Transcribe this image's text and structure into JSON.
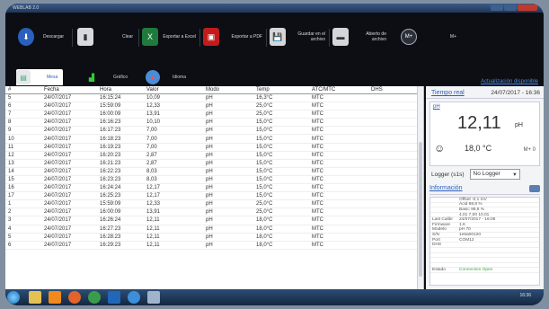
{
  "window": {
    "title": "WEBLAB 2.0"
  },
  "toolbar": {
    "items": [
      {
        "label": "Descargar",
        "icon": "download-icon"
      },
      {
        "label": "Clear",
        "icon": "beaker-icon"
      },
      {
        "label": "Exportar a Excel",
        "icon": "excel-icon"
      },
      {
        "label": "Exportar a PDF",
        "icon": "pdf-icon"
      },
      {
        "label": "Guardar en el archivo",
        "icon": "save-icon"
      },
      {
        "label": "Abierto de archivo",
        "icon": "folder-icon"
      },
      {
        "label": "M+",
        "icon": "memory-plus-icon"
      }
    ]
  },
  "tabs": [
    {
      "label": "Mesa",
      "icon": "table-icon",
      "active": true
    },
    {
      "label": "Gráfico",
      "icon": "chart-icon",
      "active": false
    },
    {
      "label": "Idioma",
      "icon": "globe-icon",
      "active": false
    }
  ],
  "update_link": "Actualización disponible",
  "table": {
    "columns": [
      "#",
      "Fecha",
      "Hora",
      "Valor",
      "Modo",
      "Temp",
      "ATC/MTC",
      "DHS"
    ],
    "rows": [
      [
        "5",
        "24/07/2017",
        "16:15:24",
        "10,09",
        "pH",
        "16,3°C",
        "MTC",
        ""
      ],
      [
        "6",
        "24/07/2017",
        "15:59:09",
        "12,33",
        "pH",
        "25,0°C",
        "MTC",
        ""
      ],
      [
        "7",
        "24/07/2017",
        "16:00:09",
        "13,91",
        "pH",
        "25,0°C",
        "MTC",
        ""
      ],
      [
        "8",
        "24/07/2017",
        "16:16:23",
        "10,10",
        "pH",
        "15,0°C",
        "MTC",
        ""
      ],
      [
        "9",
        "24/07/2017",
        "16:17:23",
        "7,00",
        "pH",
        "15,0°C",
        "MTC",
        ""
      ],
      [
        "10",
        "24/07/2017",
        "16:18:23",
        "7,00",
        "pH",
        "15,0°C",
        "MTC",
        ""
      ],
      [
        "11",
        "24/07/2017",
        "16:19:23",
        "7,00",
        "pH",
        "15,0°C",
        "MTC",
        ""
      ],
      [
        "12",
        "24/07/2017",
        "16:20:23",
        "2,87",
        "pH",
        "15,0°C",
        "MTC",
        ""
      ],
      [
        "13",
        "24/07/2017",
        "16:21:23",
        "2,87",
        "pH",
        "15,0°C",
        "MTC",
        ""
      ],
      [
        "14",
        "24/07/2017",
        "16:22:23",
        "8,03",
        "pH",
        "15,0°C",
        "MTC",
        ""
      ],
      [
        "15",
        "24/07/2017",
        "16:23:23",
        "8,03",
        "pH",
        "15,0°C",
        "MTC",
        ""
      ],
      [
        "16",
        "24/07/2017",
        "16:24:24",
        "12,17",
        "pH",
        "15,0°C",
        "MTC",
        ""
      ],
      [
        "17",
        "24/07/2017",
        "16:25:23",
        "12,17",
        "pH",
        "15,0°C",
        "MTC",
        ""
      ],
      [
        "1",
        "24/07/2017",
        "15:59:09",
        "12,33",
        "pH",
        "25,0°C",
        "MTC",
        ""
      ],
      [
        "2",
        "24/07/2017",
        "16:00:09",
        "13,91",
        "pH",
        "25,0°C",
        "MTC",
        ""
      ],
      [
        "3",
        "24/07/2017",
        "16:26:24",
        "12,11",
        "pH",
        "18,0°C",
        "MTC",
        ""
      ],
      [
        "4",
        "24/07/2017",
        "16:27:23",
        "12,11",
        "pH",
        "18,0°C",
        "MTC",
        ""
      ],
      [
        "5",
        "24/07/2017",
        "16:28:23",
        "12,11",
        "pH",
        "18,0°C",
        "MTC",
        ""
      ],
      [
        "6",
        "24/07/2017",
        "16:29:23",
        "12,11",
        "pH",
        "18,0°C",
        "MTC",
        ""
      ]
    ]
  },
  "realtime": {
    "title": "Tiempo real",
    "datetime": "24/07/2017 - 16:36",
    "mode": "pH",
    "value": "12,11",
    "unit": "pH",
    "temp": "18,0 °C",
    "mem": "M+ 0"
  },
  "logger": {
    "label": "Logger (s1s)",
    "selected": "No Logger"
  },
  "info": {
    "title": "Información",
    "rows": [
      {
        "k": "",
        "v": "Offset -0,1 mV"
      },
      {
        "k": "",
        "v": "Ácid 98,8 %"
      },
      {
        "k": "",
        "v": "Basic 98,8 %"
      },
      {
        "k": "",
        "v": "4,01 7,00 10,01"
      },
      {
        "k": "Last Calibr",
        "v": "24/07/2017 - 16:08"
      },
      {
        "k": "Firmware",
        "v": "1.6"
      },
      {
        "k": "Modelo",
        "v": "pH 70"
      },
      {
        "k": "S/N",
        "v": "1e5a00120"
      },
      {
        "k": "Port",
        "v": "COM12"
      },
      {
        "k": "DHS",
        "v": ""
      },
      {
        "k": "",
        "v": ""
      },
      {
        "k": "",
        "v": ""
      },
      {
        "k": "",
        "v": ""
      },
      {
        "k": "",
        "v": ""
      },
      {
        "k": "Estado",
        "v": "Connection Open",
        "link": true
      }
    ]
  },
  "taskbar": {
    "clock": "16:36"
  }
}
